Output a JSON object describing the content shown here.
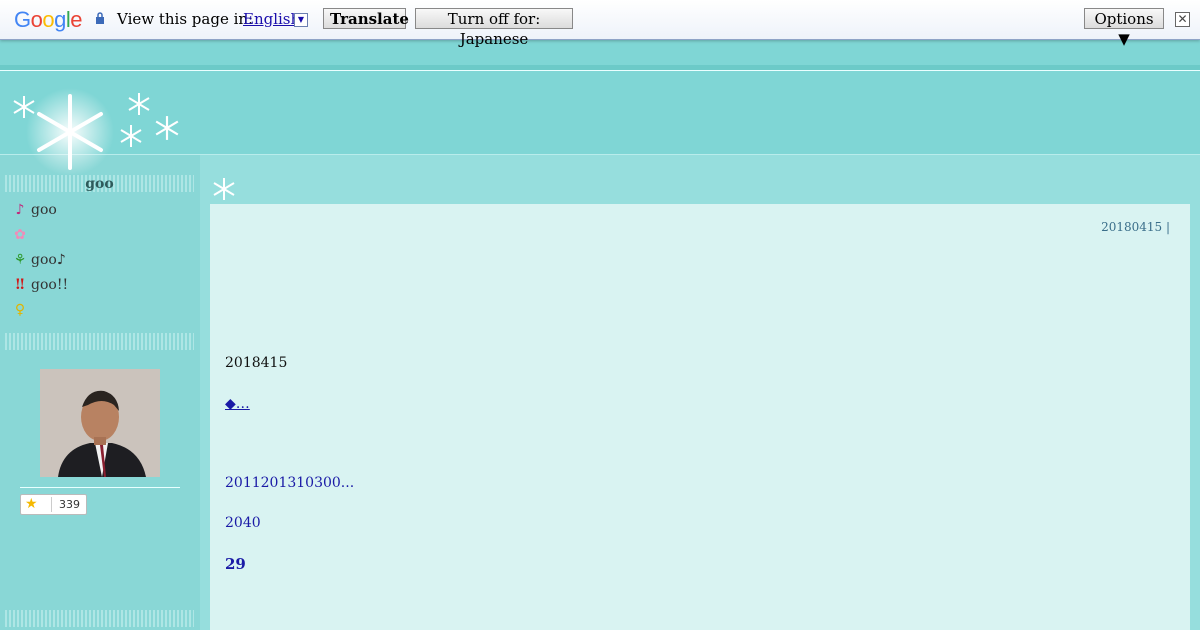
{
  "translate_bar": {
    "logo": "Google",
    "view_text": "View this page in:",
    "language": "English",
    "translate_label": "Translate",
    "turn_off_label": "Turn off for: Japanese",
    "options_label": "Options ▼",
    "close_symbol": "✕"
  },
  "sidebar": {
    "title": "goo",
    "items": [
      {
        "icon": "music-note-icon",
        "glyph": "♪",
        "label": "goo"
      },
      {
        "icon": "flower-icon",
        "glyph": "✿",
        "label": ""
      },
      {
        "icon": "sprout-icon",
        "glyph": "⚘",
        "label": "goo♪"
      },
      {
        "icon": "exclamation-icon",
        "glyph": "‼",
        "label": "goo!!"
      },
      {
        "icon": "lightbulb-icon",
        "glyph": "♀",
        "label": ""
      }
    ],
    "star_count": "339"
  },
  "post": {
    "date": "20180415 |",
    "date_line": "2018415",
    "link_text": "◆…",
    "line_1": "2011201310300...",
    "line_2": "2040",
    "line_3": "29"
  },
  "colors": {
    "background": "#7fd6d5",
    "content_bg": "#d9f3f2",
    "link": "#1a1aa6"
  }
}
